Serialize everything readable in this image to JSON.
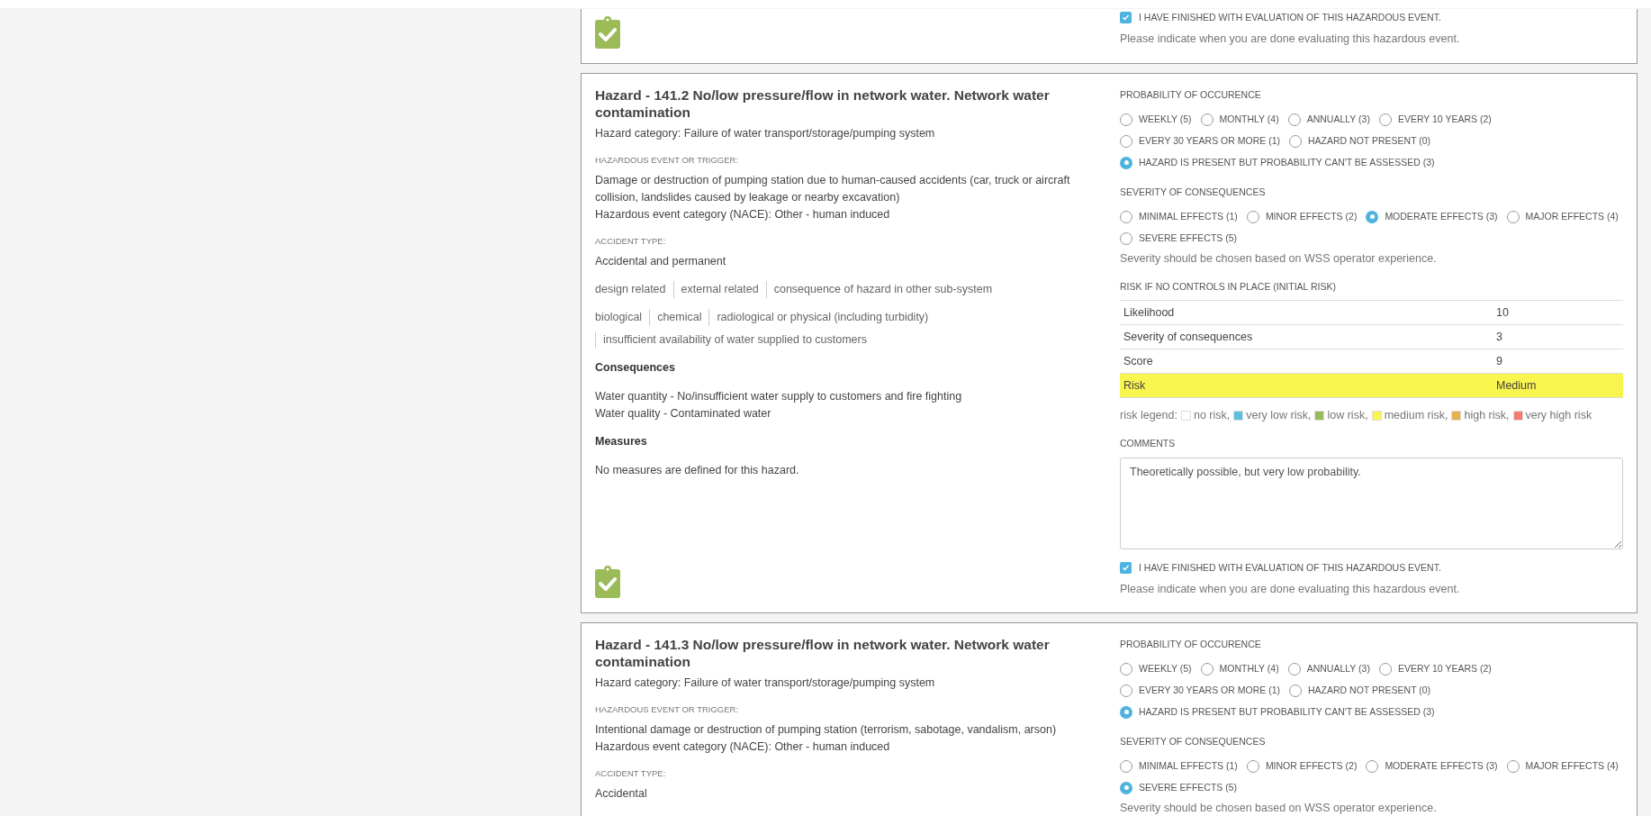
{
  "hazards": [
    {
      "finished_label": "I HAVE FINISHED WITH EVALUATION OF THIS HAZARDOUS EVENT.",
      "finished": true,
      "finished_note": "Please indicate when you are done evaluating this hazardous event."
    },
    {
      "title": "Hazard - 141.2 No/low pressure/flow in network water. Network water contamination",
      "category": "Hazard category: Failure of water transport/storage/pumping system",
      "event_label": "HAZARDOUS EVENT OR TRIGGER:",
      "event": "Damage or destruction of pumping station due to human-caused accidents (car, truck or aircraft collision, landslides caused by leakage or nearby excavation)",
      "event_category": "Hazardous event category (NACE): Other - human induced",
      "accident_label": "ACCIDENT TYPE:",
      "accident_type": "Accidental and permanent",
      "tag_groups": [
        [
          "design related",
          "external related",
          "consequence of hazard in other sub-system"
        ],
        [
          "biological",
          "chemical",
          "radiological or physical (including turbidity)",
          "insufficient availability of water supplied to customers"
        ]
      ],
      "consequences_heading": "Consequences",
      "consequences": [
        "Water quantity - No/insufficient water supply to customers and fire fighting",
        "Water quality - Contaminated water"
      ],
      "measures_heading": "Measures",
      "measures": "No measures are defined for this hazard.",
      "probability": {
        "label": "PROBABILITY OF OCCURENCE",
        "options": [
          {
            "label": "WEEKLY (5)",
            "selected": false
          },
          {
            "label": "MONTHLY (4)",
            "selected": false
          },
          {
            "label": "ANNUALLY (3)",
            "selected": false
          },
          {
            "label": "EVERY 10 YEARS (2)",
            "selected": false
          },
          {
            "label": "EVERY 30 YEARS OR MORE (1)",
            "selected": false
          },
          {
            "label": "HAZARD NOT PRESENT (0)",
            "selected": false
          },
          {
            "label": "HAZARD IS PRESENT BUT PROBABILITY CAN'T BE ASSESSED (3)",
            "selected": true
          }
        ]
      },
      "severity": {
        "label": "SEVERITY OF CONSEQUENCES",
        "options": [
          {
            "label": "MINIMAL EFFECTS (1)",
            "selected": false
          },
          {
            "label": "MINOR EFFECTS (2)",
            "selected": false
          },
          {
            "label": "MODERATE EFFECTS (3)",
            "selected": true
          },
          {
            "label": "MAJOR EFFECTS (4)",
            "selected": false
          },
          {
            "label": "SEVERE EFFECTS (5)",
            "selected": false
          }
        ],
        "note": "Severity should be chosen based on WSS operator experience."
      },
      "risk": {
        "label": "RISK IF NO CONTROLS IN PLACE (INITIAL RISK)",
        "rows": [
          {
            "label": "Likelihood",
            "value": "10"
          },
          {
            "label": "Severity of consequences",
            "value": "3"
          },
          {
            "label": "Score",
            "value": "9"
          },
          {
            "label": "Risk",
            "value": "Medium",
            "color": "#f9f54f"
          }
        ],
        "legend_label": "risk legend:",
        "legend": [
          {
            "label": "no risk,",
            "color": "#ffffff"
          },
          {
            "label": "very low risk,",
            "color": "#5bc0de"
          },
          {
            "label": "low risk,",
            "color": "#9bbb59"
          },
          {
            "label": "medium risk,",
            "color": "#f9f54f"
          },
          {
            "label": "high risk,",
            "color": "#e8b04e"
          },
          {
            "label": "very high risk",
            "color": "#f47c72"
          }
        ]
      },
      "comments": {
        "label": "COMMENTS",
        "value": "Theoretically possible, but very low probability."
      },
      "finished_label": "I HAVE FINISHED WITH EVALUATION OF THIS HAZARDOUS EVENT.",
      "finished": true,
      "finished_note": "Please indicate when you are done evaluating this hazardous event."
    },
    {
      "title": "Hazard - 141.3 No/low pressure/flow in network water. Network water contamination",
      "category": "Hazard category: Failure of water transport/storage/pumping system",
      "event_label": "HAZARDOUS EVENT OR TRIGGER:",
      "event": "Intentional damage or destruction of pumping station (terrorism, sabotage, vandalism, arson)",
      "event_category": "Hazardous event category (NACE): Other - human induced",
      "accident_label": "ACCIDENT TYPE:",
      "accident_type": "Accidental",
      "probability": {
        "label": "PROBABILITY OF OCCURENCE",
        "options": [
          {
            "label": "WEEKLY (5)",
            "selected": false
          },
          {
            "label": "MONTHLY (4)",
            "selected": false
          },
          {
            "label": "ANNUALLY (3)",
            "selected": false
          },
          {
            "label": "EVERY 10 YEARS (2)",
            "selected": false
          },
          {
            "label": "EVERY 30 YEARS OR MORE (1)",
            "selected": false
          },
          {
            "label": "HAZARD NOT PRESENT (0)",
            "selected": false
          },
          {
            "label": "HAZARD IS PRESENT BUT PROBABILITY CAN'T BE ASSESSED (3)",
            "selected": true
          }
        ]
      },
      "severity": {
        "label": "SEVERITY OF CONSEQUENCES",
        "options": [
          {
            "label": "MINIMAL EFFECTS (1)",
            "selected": false
          },
          {
            "label": "MINOR EFFECTS (2)",
            "selected": false
          },
          {
            "label": "MODERATE EFFECTS (3)",
            "selected": false
          },
          {
            "label": "MAJOR EFFECTS (4)",
            "selected": false
          },
          {
            "label": "SEVERE EFFECTS (5)",
            "selected": true
          }
        ],
        "note": "Severity should be chosen based on WSS operator experience."
      }
    }
  ]
}
